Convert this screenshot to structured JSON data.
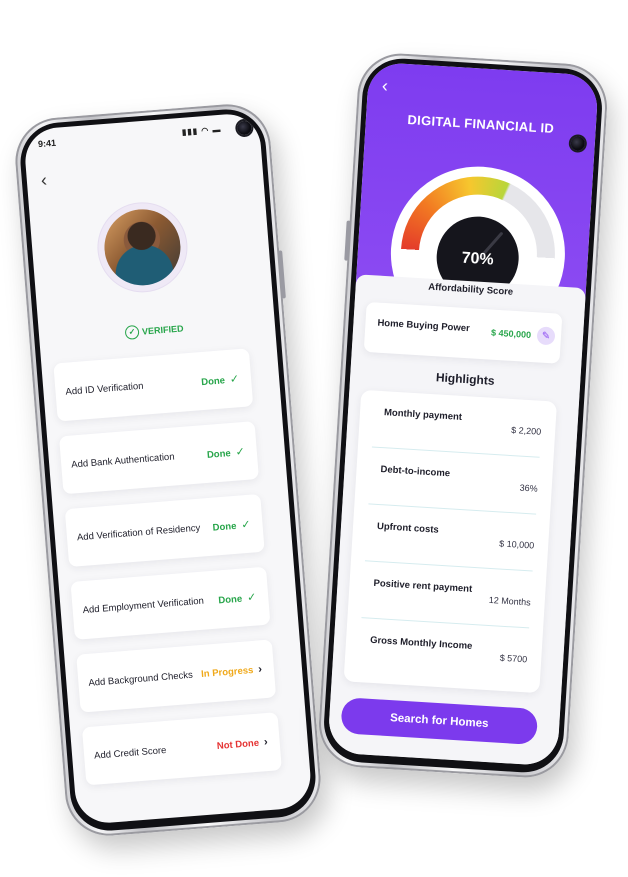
{
  "left_phone": {
    "status_time": "9:41",
    "status_icons": "▮▮▮ ◠ ▬",
    "back_glyph": "‹",
    "verified_label": "VERIFIED",
    "tasks": [
      {
        "label": "Add ID Verification",
        "status": "Done",
        "mark": "✓"
      },
      {
        "label": "Add Bank Authentication",
        "status": "Done",
        "mark": "✓"
      },
      {
        "label": "Add Verification of Residency",
        "status": "Done",
        "mark": "✓"
      },
      {
        "label": "Add Employment Verification",
        "status": "Done",
        "mark": "✓"
      },
      {
        "label": "Add Background Checks",
        "status": "In Progress",
        "mark": "›"
      },
      {
        "label": "Add Credit Score",
        "status": "Not Done",
        "mark": "›"
      }
    ],
    "colors": {
      "done": "#27a54a",
      "in_progress": "#f0a91a",
      "not_done": "#e53333"
    }
  },
  "right_phone": {
    "back_glyph": "‹",
    "title": "DIGITAL FINANCIAL ID",
    "gauge_value": "70%",
    "gauge_caption": "Affordability Score",
    "home_buying_power_label": "Home Buying Power",
    "home_buying_power_value": "$ 450,000",
    "edit_icon": "✎",
    "highlights_title": "Highlights",
    "highlights": [
      {
        "label": "Monthly payment",
        "value": "$ 2,200"
      },
      {
        "label": "Debt-to-income",
        "value": "36%"
      },
      {
        "label": "Upfront costs",
        "value": "$ 10,000"
      },
      {
        "label": "Positive rent payment",
        "value": "12 Months"
      },
      {
        "label": "Gross Monthly Income",
        "value": "$ 5700"
      }
    ],
    "cta_label": "Search for Homes",
    "colors": {
      "brand_purple": "#7c3aed",
      "value_green": "#27a54a"
    }
  }
}
